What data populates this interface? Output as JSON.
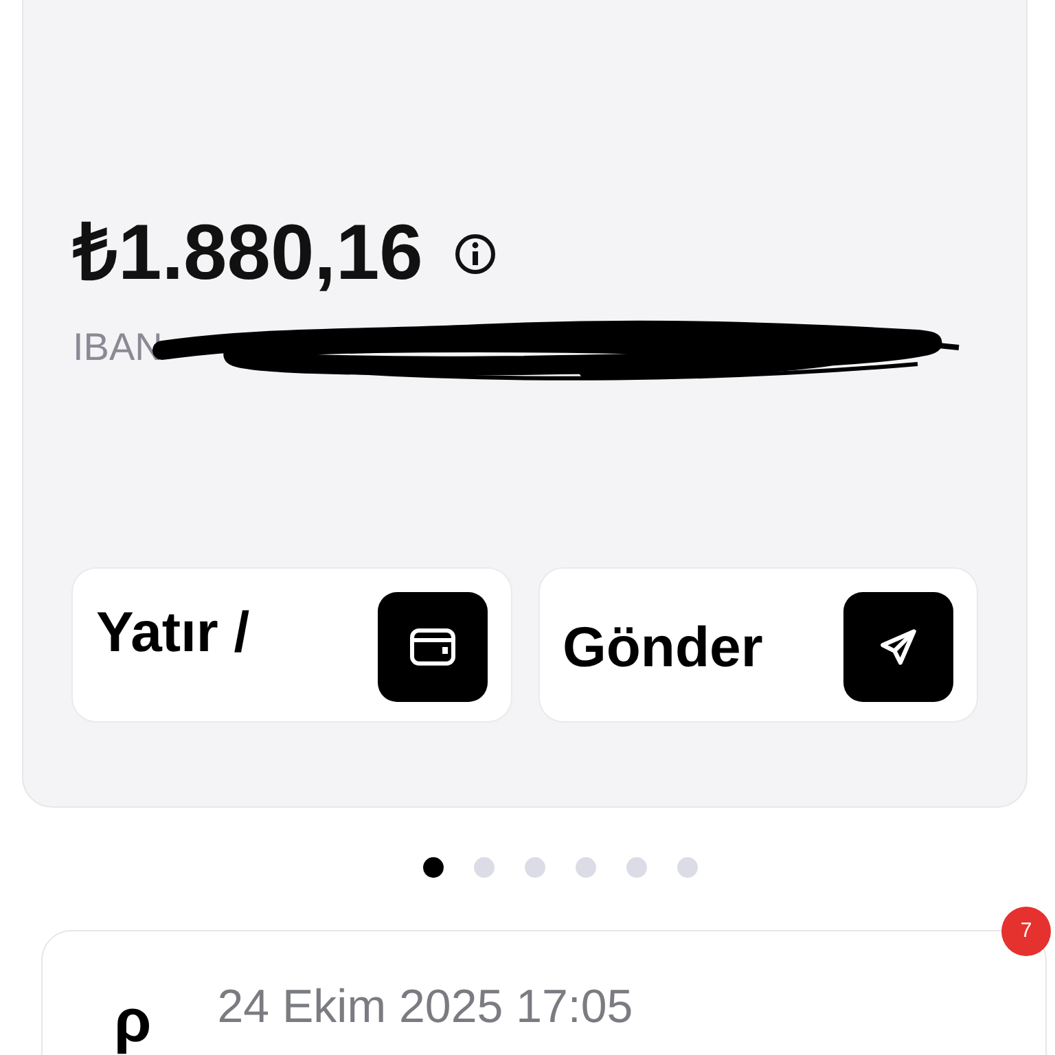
{
  "account_card": {
    "balance": "₺1.880,16",
    "iban_label": "IBAN",
    "actions": [
      {
        "label": "Yatır /",
        "kind": "wallet"
      },
      {
        "label": "Gönder",
        "kind": "send"
      }
    ]
  },
  "pager_dots": [
    {
      "selected": true
    },
    {
      "selected": false
    },
    {
      "selected": false
    },
    {
      "selected": false
    },
    {
      "selected": false
    },
    {
      "selected": false
    }
  ],
  "notification": {
    "badge": "7",
    "logo": "ρ",
    "date": "24 Ekim 2025 17:05"
  }
}
